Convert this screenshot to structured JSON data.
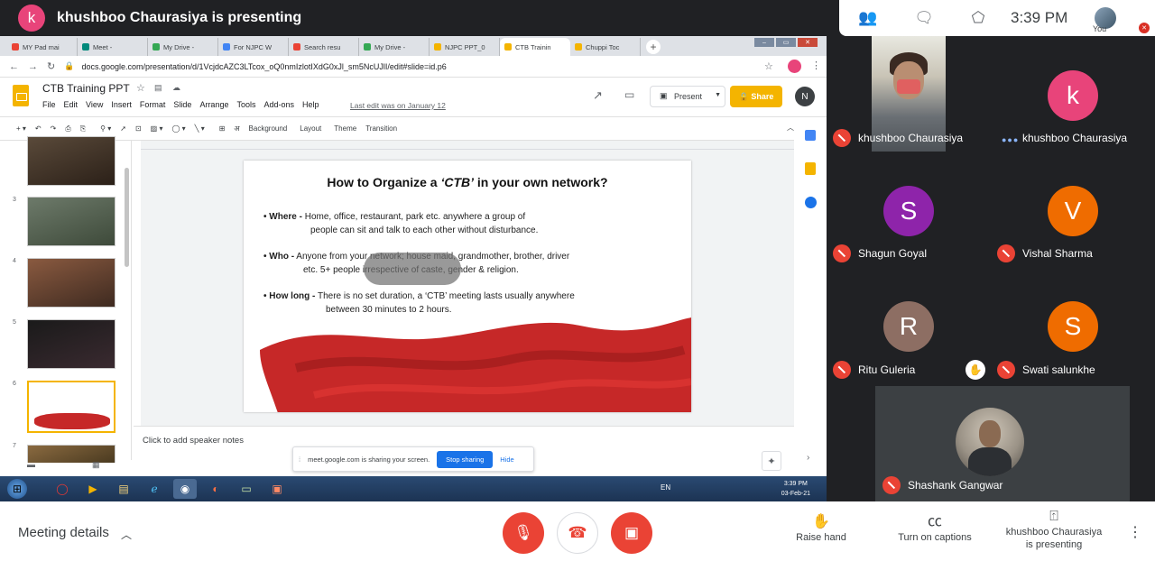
{
  "presenter_bar": {
    "avatar_letter": "k",
    "title": "khushboo Chaurasiya is presenting"
  },
  "top_right": {
    "time": "3:39 PM",
    "you_label": "You"
  },
  "browser": {
    "tabs": [
      "MY Pad mai",
      "Meet -",
      "My Drive -",
      "For NJPC W",
      "Search resu",
      "My Drive -",
      "NJPC PPT_0",
      "CTB Trainin",
      "Chuppi Toc"
    ],
    "active_tab_index": 7,
    "url": "docs.google.com/presentation/d/1VcjdcAZC3LTcox_oQ0nmIzlotIXdG0xJl_sm5NcUJlI/edit#slide=id.p6"
  },
  "slides_app": {
    "doc_title": "CTB Training PPT",
    "menu": [
      "File",
      "Edit",
      "View",
      "Insert",
      "Format",
      "Slide",
      "Arrange",
      "Tools",
      "Add-ons",
      "Help"
    ],
    "last_edit": "Last edit was on January 12",
    "present_label": "Present",
    "share_label": "Share",
    "user_initial": "N",
    "toolbar": [
      "Background",
      "Layout",
      "Theme",
      "Transition"
    ],
    "slide_numbers": [
      "3",
      "4",
      "5",
      "6",
      "7"
    ],
    "speaker_notes": "Click to add speaker notes"
  },
  "slide": {
    "title_prefix": "How to Organize a ",
    "title_em": "‘CTB’",
    "title_suffix": " in your own network?",
    "bullets": [
      {
        "label": "• Where -",
        "line1": " Home, office, restaurant, park etc. anywhere a group of",
        "line2": "people can sit and talk to each other without disturbance."
      },
      {
        "label": "• Who -",
        "line1": " Anyone from your network; house maid, grandmother, brother, driver",
        "line2": "etc.  5+ people irrespective of caste, gender & religion."
      },
      {
        "label": "• How long -",
        "line1": " There is no set duration, a ‘CTB’ meeting lasts usually anywhere",
        "line2": "between 30 minutes to 2 hours."
      }
    ]
  },
  "share_notice": {
    "text": "meet.google.com is sharing your screen.",
    "stop": "Stop sharing",
    "hide": "Hide"
  },
  "taskbar": {
    "lang": "EN",
    "time": "3:39 PM",
    "date": "03-Feb-21"
  },
  "participants": [
    {
      "name": "khushboo Chaurasiya"
    },
    {
      "name": "khushboo Chaurasiya",
      "letter": "k",
      "color": "#e8447a"
    },
    {
      "name": "Shagun Goyal",
      "letter": "S",
      "color": "#8e24aa"
    },
    {
      "name": "Vishal Sharma",
      "letter": "V",
      "color": "#ef6c00"
    },
    {
      "name": "Ritu Guleria",
      "letter": "R",
      "color": "#8d6e63"
    },
    {
      "name": "Swati salunkhe",
      "letter": "S",
      "color": "#ef6c00"
    },
    {
      "name": "Shashank Gangwar"
    }
  ],
  "bottom": {
    "meeting_details": "Meeting details",
    "raise_hand": "Raise hand",
    "captions": "Turn on captions",
    "presenting": [
      "khushboo Chaurasiya",
      "is presenting"
    ]
  },
  "colors": {
    "mute_red": "#ea4335",
    "share_yellow": "#f4b400",
    "stop_blue": "#1a73e8",
    "dark_bg": "#202124"
  }
}
